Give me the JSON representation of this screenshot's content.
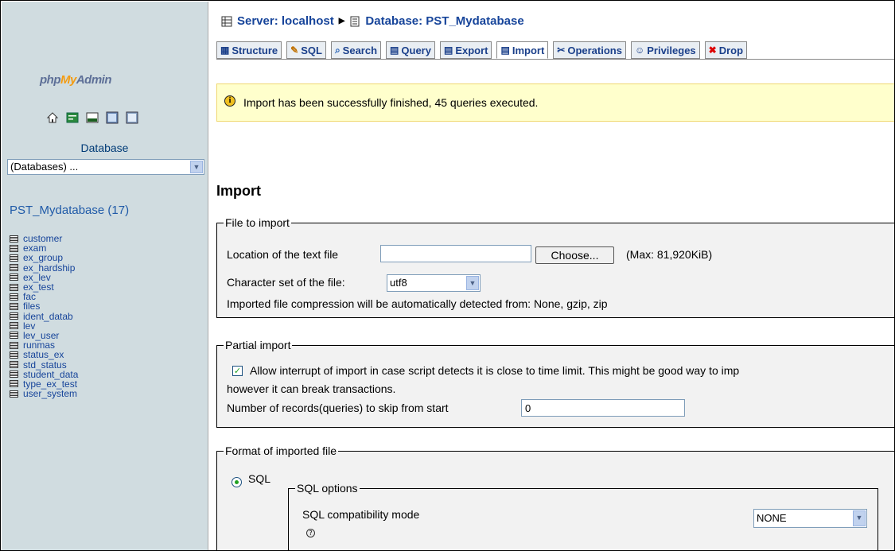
{
  "sidebar": {
    "logo": {
      "prefix": "php",
      "highlight": "My",
      "suffix": "Admin"
    },
    "icons": [
      "home-icon",
      "exit-icon",
      "sql-icon",
      "query-window-icon",
      "docs-icon"
    ],
    "database_label": "Database",
    "database_select_value": "(Databases) ...",
    "current_db": "PST_Mydatabase (17)",
    "tables": [
      "customer",
      "exam",
      "ex_group",
      "ex_hardship",
      "ex_lev",
      "ex_test",
      "fac",
      "files",
      "ident_datab",
      "lev",
      "lev_user",
      "runmas",
      "status_ex",
      "std_status",
      "student_data",
      "type_ex_test",
      "user_system"
    ]
  },
  "breadcrumb": {
    "server": "Server: localhost",
    "database": "Database: PST_Mydatabase"
  },
  "tabs": [
    {
      "label": "Structure"
    },
    {
      "label": "SQL"
    },
    {
      "label": "Search"
    },
    {
      "label": "Query"
    },
    {
      "label": "Export"
    },
    {
      "label": "Import"
    },
    {
      "label": "Operations"
    },
    {
      "label": "Privileges"
    },
    {
      "label": "Drop"
    }
  ],
  "notice": "Import has been successfully finished, 45 queries executed.",
  "page_title": "Import",
  "file_to_import": {
    "legend": "File to import",
    "location_label": "Location of the text file",
    "location_value": "",
    "choose_label": "Choose...",
    "max_label": "(Max: 81,920KiB)",
    "charset_label": "Character set of the file:",
    "charset_value": "utf8",
    "compression_note": "Imported file compression will be automatically detected from: None, gzip, zip"
  },
  "partial_import": {
    "legend": "Partial import",
    "allow_interrupt_text": "Allow interrupt of import in case script detects it is close to time limit. This might be good way to imp",
    "allow_interrupt_cont": "however it can break transactions.",
    "allow_interrupt_checked": true,
    "skip_label": "Number of records(queries) to skip from start",
    "skip_value": "0"
  },
  "format": {
    "legend": "Format of imported file",
    "sql_label": "SQL",
    "sql_selected": true,
    "options_legend": "SQL options",
    "compat_label": "SQL compatibility mode",
    "compat_value": "NONE"
  }
}
